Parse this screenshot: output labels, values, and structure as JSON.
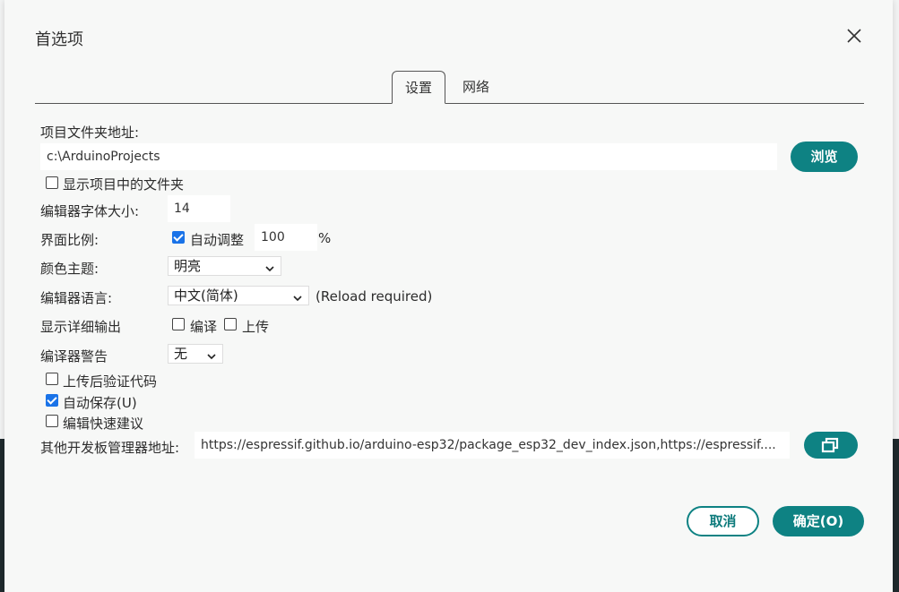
{
  "dialog": {
    "title": "首选项"
  },
  "tabs": [
    {
      "label": "设置",
      "active": true
    },
    {
      "label": "网络",
      "active": false
    }
  ],
  "settings": {
    "sketchbook_label": "项目文件夹地址:",
    "sketchbook_value": "c:\\ArduinoProjects",
    "browse_button": "浏览",
    "show_files_label": "显示项目中的文件夹",
    "show_files_checked": false,
    "font_size_label": "编辑器字体大小:",
    "font_size_value": "14",
    "scale_label": "界面比例:",
    "auto_scale_label": "自动调整",
    "auto_scale_checked": true,
    "scale_value": "100",
    "scale_unit": "%",
    "theme_label": "颜色主题:",
    "theme_value": "明亮",
    "language_label": "编辑器语言:",
    "language_value": "中文(简体)",
    "language_note": "(Reload required)",
    "verbose_label": "显示详细输出",
    "verbose_compile_label": "编译",
    "verbose_compile_checked": false,
    "verbose_upload_label": "上传",
    "verbose_upload_checked": false,
    "warnings_label": "编译器警告",
    "warnings_value": "无",
    "verify_label": "上传后验证代码",
    "verify_checked": false,
    "autosave_label": "自动保存(U)",
    "autosave_checked": true,
    "quick_suggestions_label": "编辑快速建议",
    "quick_suggestions_checked": false,
    "board_urls_label": "其他开发板管理器地址:",
    "board_urls_value": "https://espressif.github.io/arduino-esp32/package_esp32_dev_index.json,https://espressif...."
  },
  "footer": {
    "cancel_button": "取消",
    "ok_button": "确定(O)"
  },
  "colors": {
    "accent": "#0e8283",
    "checkbox_checked": "#1a73e8",
    "background": "#f7f8f7"
  },
  "icons": {
    "close": "close-icon",
    "url_editor": "window-restore-icon",
    "dropdown": "chevron-down-icon"
  }
}
